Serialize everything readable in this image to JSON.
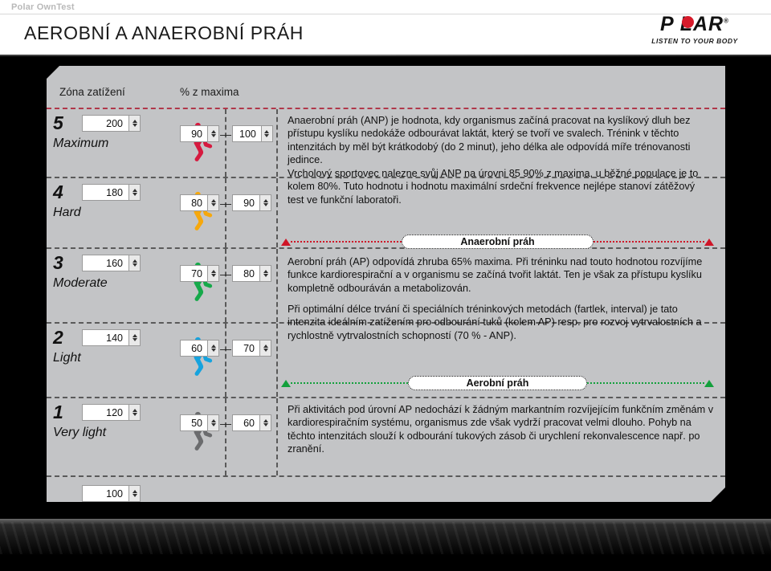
{
  "header": {
    "brand_line": "Polar OwnTest",
    "title": "AEROBNÍ A ANAEROBNÍ PRÁH",
    "logo": {
      "word": "P LAR",
      "registered": "®",
      "tagline": "LISTEN TO YOUR BODY"
    }
  },
  "columns": {
    "zone": "Zóna zatížení",
    "percent": "% z maxima"
  },
  "zones": [
    {
      "num": "5",
      "name": "Maximum",
      "bpm": "200",
      "pct_low": "90",
      "pct_high": "100",
      "color": "#e31b3d",
      "filled": 5,
      "runner_color": "#d61a3f"
    },
    {
      "num": "4",
      "name": "Hard",
      "bpm": "180",
      "pct_low": "80",
      "pct_high": "90",
      "color": "#f59100",
      "filled": 4,
      "runner_color": "#f6a80d"
    },
    {
      "num": "3",
      "name": "Moderate",
      "bpm": "160",
      "pct_low": "70",
      "pct_high": "80",
      "color": "#1fa33f",
      "filled": 3,
      "runner_color": "#16a94a"
    },
    {
      "num": "2",
      "name": "Light",
      "bpm": "140",
      "pct_low": "60",
      "pct_high": "70",
      "color": "#1c9ad6",
      "filled": 2,
      "runner_color": "#16a3de"
    },
    {
      "num": "1",
      "name": "Very light",
      "bpm": "120",
      "pct_low": "50",
      "pct_high": "60",
      "color": "#8e9093",
      "filled": 1,
      "runner_color": "#6b6c6e"
    }
  ],
  "bottom_spinner": {
    "bpm": "100"
  },
  "dash_separator": "—",
  "text": {
    "anaerobic_paragraphs": [
      "Anaerobní práh (ANP) je hodnota, kdy organismus začíná pracovat na kyslíkový dluh  bez přístupu kyslíku nedokáže odbourávat laktát, který se tvoří ve svalech. Trénink v těchto intenzitách by měl být krátkodobý (do 2 minut), jeho délka ale odpovídá míře trénovanosti jedince.",
      "Vrcholový sportovec nalezne svůj ANP na úrovni 85  90% z maxima, u běžné populace je to kolem 80%. Tuto hodnotu i hodnotu maximální srdeční frekvence nejlépe stanoví zátěžový test ve funkční laboratoři."
    ],
    "anaerobic_marker": "Anaerobní práh",
    "aerobic_paragraphs": [
      "Aerobní práh (AP) odpovídá zhruba 65% maxima. Při tréninku nad touto hodnotou rozvíjíme funkce kardiorespirační a v organismu se začíná tvořit laktát. Ten je však za přístupu kyslíku kompletně odbouráván a metabolizován.",
      "Při optimální délce trvání či speciálních tréninkových metodách (fartlek, interval) je tato intenzita ideálním zatížením pro odbourání tuků (kolem AP) resp. pro rozvoj vytrvalostních a rychlostně vytrvalostních schopností (70 % - ANP)."
    ],
    "aerobic_marker": "Aerobní práh",
    "below_aerobic_paragraph": "Při aktivitách pod úrovní AP nedochází k žádným markantním rozvíjejícím funkčním změnám v kardiorespiračním systému, organismus zde však vydrží pracovat velmi dlouho. Pohyb na těchto intenzitách slouží k odbourání tukových zásob či urychlení rekonvalescence např. po zranění."
  }
}
